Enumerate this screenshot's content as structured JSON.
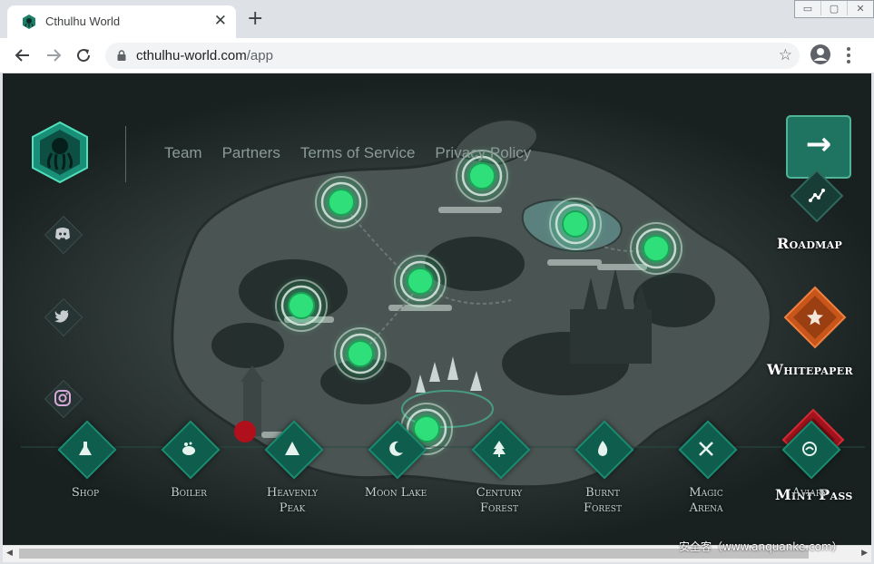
{
  "browser": {
    "tab_title": "Cthulhu World",
    "tab_close": "✕",
    "new_tab": "+",
    "url_host": "cthulhu-world.com",
    "url_path": "/app",
    "window_controls": [
      "▭",
      "▢",
      "✕"
    ]
  },
  "nav": {
    "links": [
      {
        "label": "Team"
      },
      {
        "label": "Partners"
      },
      {
        "label": "Terms of Service"
      },
      {
        "label": "Privacy Policy"
      }
    ]
  },
  "social": [
    "discord-icon",
    "twitter-icon",
    "instagram-icon"
  ],
  "right_menu": {
    "next_arrow": "→",
    "roadmap": "Roadmap",
    "whitepaper": "Whitepaper",
    "mint_pass": "Mint Pass",
    "mint_symbol": "+"
  },
  "locations": [
    {
      "line1": "Shop",
      "line2": "",
      "icon": "flask-icon"
    },
    {
      "line1": "Boiler",
      "line2": "",
      "icon": "cauldron-icon"
    },
    {
      "line1": "Heavenly",
      "line2": "Peak",
      "icon": "mountain-icon"
    },
    {
      "line1": "Moon Lake",
      "line2": "",
      "icon": "moon-icon"
    },
    {
      "line1": "Century",
      "line2": "Forest",
      "icon": "tree-icon"
    },
    {
      "line1": "Burnt",
      "line2": "Forest",
      "icon": "flame-icon"
    },
    {
      "line1": "Magic",
      "line2": "Arena",
      "icon": "crossed-swords-icon"
    },
    {
      "line1": "Aviary",
      "line2": "",
      "icon": "bird-icon"
    }
  ],
  "watermark": "安全客（www.anquanke.com）",
  "colors": {
    "accent_green": "#1c8a70",
    "marker_green": "#2fe07a",
    "whitepaper_orange": "#c8561b",
    "mint_red": "#a3141d"
  }
}
